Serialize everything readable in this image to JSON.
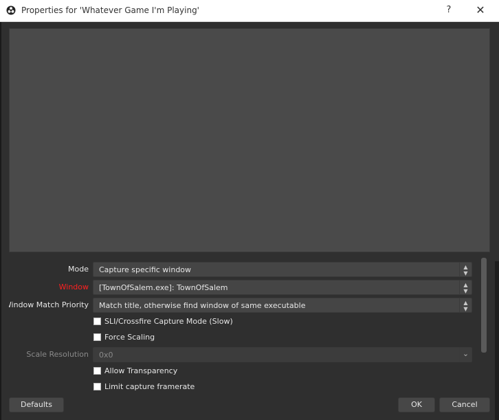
{
  "window": {
    "title": "Properties for 'Whatever Game I'm Playing'",
    "help_label": "?",
    "close_label": "✕",
    "app_icon": "obs-logo-icon"
  },
  "properties": {
    "mode": {
      "label": "Mode",
      "value": "Capture specific window"
    },
    "window": {
      "label": "Window",
      "value": "[TownOfSalem.exe]: TownOfSalem"
    },
    "window_match_priority": {
      "label": "Window Match Priority",
      "value": "Match title, otherwise find window of same executable"
    },
    "sli_crossfire": {
      "label": "SLI/Crossfire Capture Mode (Slow)",
      "checked": false
    },
    "force_scaling": {
      "label": "Force Scaling",
      "checked": false
    },
    "scale_resolution": {
      "label": "Scale Resolution",
      "value": "0x0"
    },
    "allow_transparency": {
      "label": "Allow Transparency",
      "checked": false
    },
    "limit_capture_framerate": {
      "label": "Limit capture framerate",
      "checked": false
    }
  },
  "buttons": {
    "defaults": "Defaults",
    "ok": "OK",
    "cancel": "Cancel"
  },
  "colors": {
    "window_label_warning": "#ff2020",
    "background": "#2f2f2f",
    "preview": "#4a4a4a"
  }
}
